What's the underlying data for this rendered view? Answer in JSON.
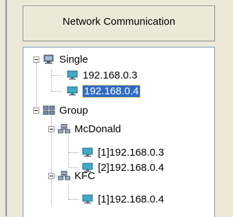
{
  "header": {
    "title": "Network Communication"
  },
  "tree": {
    "single": {
      "label": "Single",
      "items": [
        "192.168.0.3",
        "192.168.0.4"
      ]
    },
    "group": {
      "label": "Group",
      "subgroups": [
        {
          "label": "McDonald",
          "items": [
            "[1]192.168.0.3",
            "[2]192.168.0.4"
          ]
        },
        {
          "label": "KFC",
          "items": [
            "[1]192.168.0.4"
          ]
        }
      ]
    },
    "selected_item": "192.168.0.4"
  },
  "colors": {
    "selection_bg": "#316ac5",
    "panel_bg": "#ece9d8",
    "monitor_screen": "#3fa9c8"
  }
}
